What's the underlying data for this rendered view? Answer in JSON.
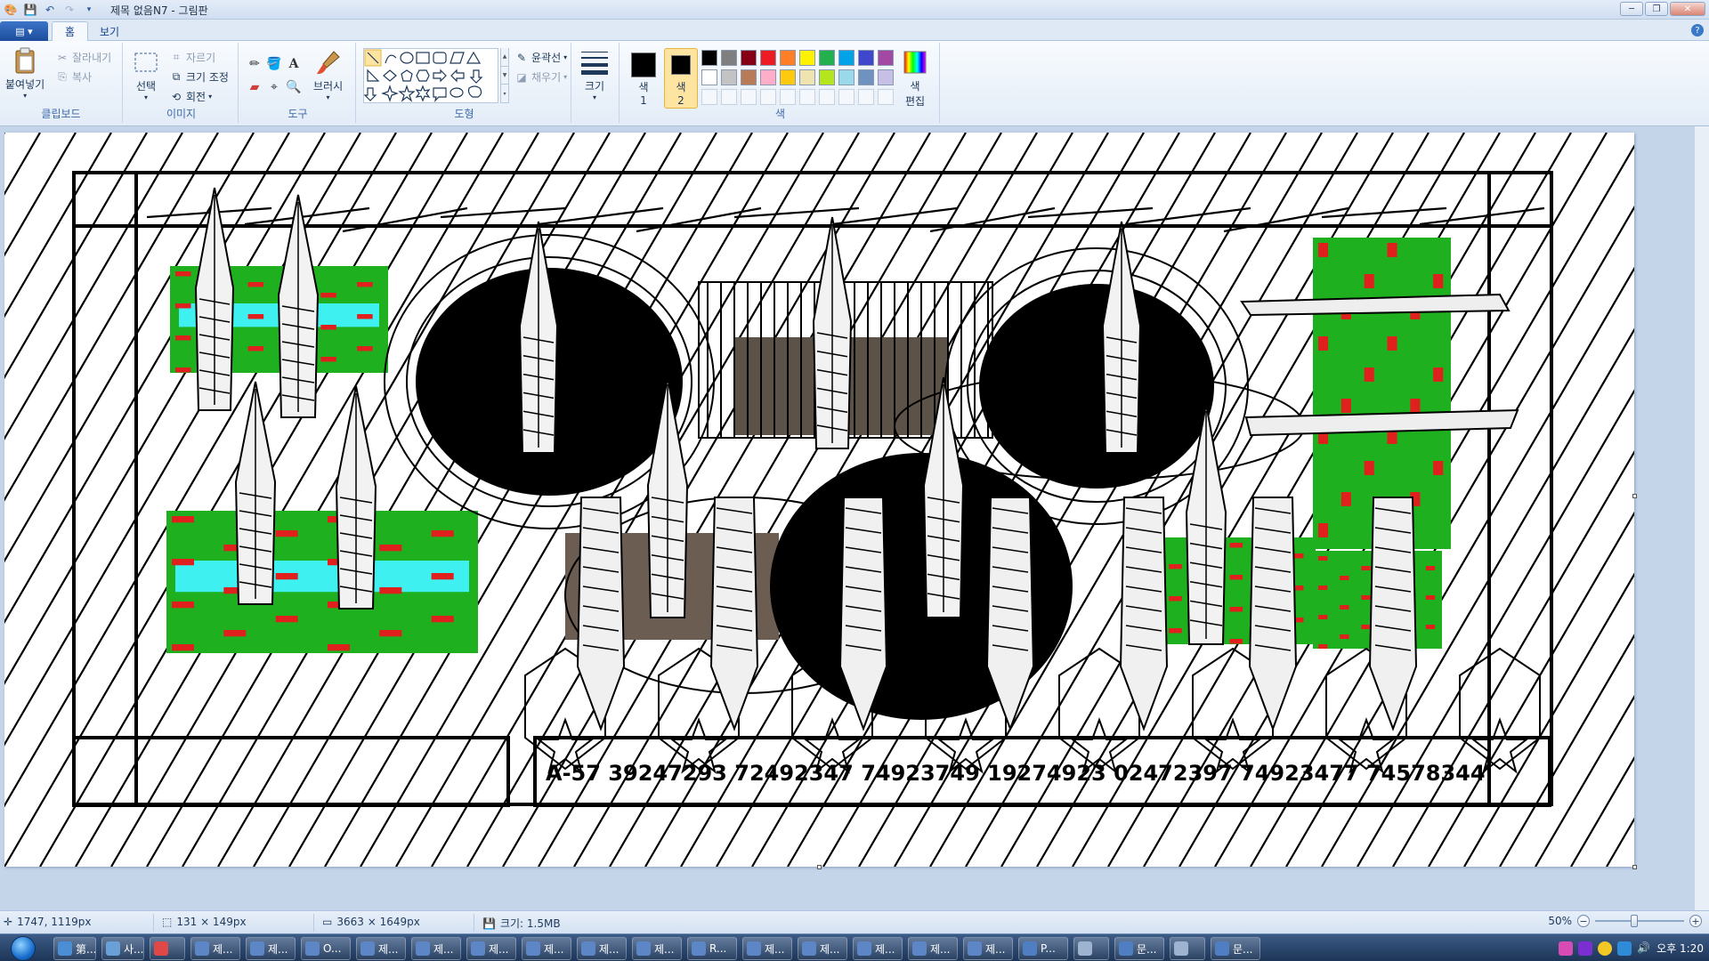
{
  "window": {
    "title": "제목 없음N7 - 그림판",
    "controls": {
      "minimize": "─",
      "maximize": "❐",
      "close": "✕"
    }
  },
  "quick_access": [
    "save-icon",
    "undo-icon",
    "redo-icon",
    "customize-icon"
  ],
  "tabs": {
    "file": "▤ ▾",
    "home": "홈",
    "view": "보기",
    "help": "?"
  },
  "ribbon": {
    "clipboard": {
      "label": "클립보드",
      "paste": "붙여넣기",
      "cut": "잘라내기",
      "copy": "복사"
    },
    "image": {
      "label": "이미지",
      "select": "선택",
      "crop": "자르기",
      "resize": "크기 조정",
      "rotate": "회전"
    },
    "tools": {
      "label": "도구",
      "brushes": "브러시"
    },
    "shapes": {
      "label": "도형",
      "outline": "윤곽선",
      "fill": "채우기"
    },
    "size": {
      "label": "크기"
    },
    "colors": {
      "label": "색",
      "color1": "색\n1",
      "color1_line1": "색",
      "color1_line2": "1",
      "color2_line1": "색",
      "color2_line2": "2",
      "edit_line1": "색",
      "edit_line2": "편집",
      "color1_value": "#000000",
      "color2_value": "#000000",
      "palette": [
        "#000000",
        "#7f7f7f",
        "#880015",
        "#ed1c24",
        "#ff7f27",
        "#fff200",
        "#22b14c",
        "#00a2e8",
        "#3f48cc",
        "#a349a4",
        "#ffffff",
        "#c3c3c3",
        "#b97a57",
        "#ffaec9",
        "#ffc90e",
        "#efe4b0",
        "#b5e61d",
        "#99d9ea",
        "#7092be",
        "#c8bfe7"
      ]
    }
  },
  "canvas": {
    "serial_text": "A-57  39247293  72492347  74923749  19274923  02472397  74923477  74578344"
  },
  "status": {
    "cursor": "1747, 1119px",
    "selection": "131 × 149px",
    "image_size": "3663 × 1649px",
    "file_size": "크기: 1.5MB",
    "zoom": "50%"
  },
  "taskbar": {
    "buttons": [
      "第...",
      "사...",
      "",
      "제...",
      "제...",
      "O...",
      "제...",
      "제...",
      "제...",
      "제...",
      "제...",
      "제...",
      "R...",
      "제...",
      "제...",
      "제...",
      "제...",
      "제...",
      "P...",
      "",
      "문...",
      "",
      "문..."
    ],
    "clock": "오후 1:20"
  }
}
